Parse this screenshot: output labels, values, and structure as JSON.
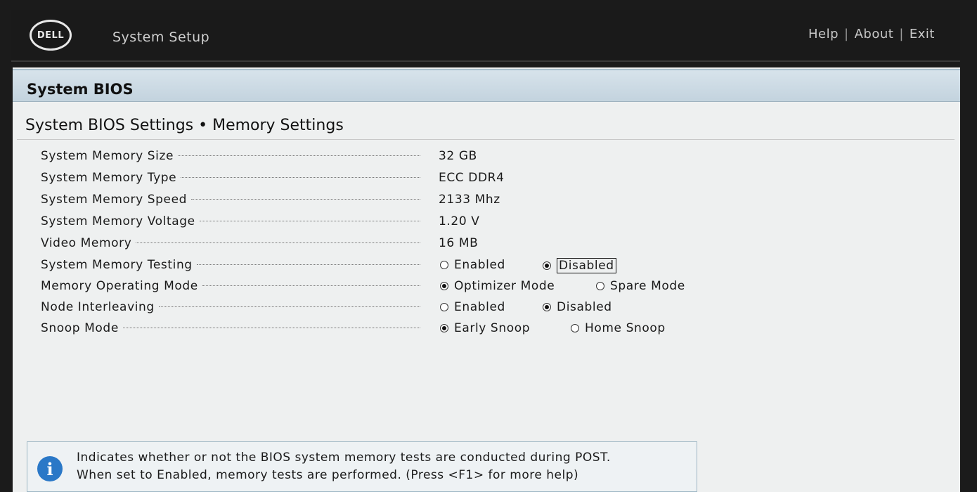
{
  "header": {
    "logo_text": "DELL",
    "app_title": "System Setup",
    "links": [
      "Help",
      "About",
      "Exit"
    ],
    "separator": "|"
  },
  "section": {
    "title": "System BIOS"
  },
  "page": {
    "title": "System BIOS Settings • Memory Settings"
  },
  "settings": [
    {
      "label": "System Memory Size",
      "value": "32 GB"
    },
    {
      "label": "System Memory Type",
      "value": "ECC DDR4"
    },
    {
      "label": "System Memory Speed",
      "value": "2133 Mhz"
    },
    {
      "label": "System Memory Voltage",
      "value": "1.20 V"
    },
    {
      "label": "Video Memory",
      "value": "16 MB"
    },
    {
      "label": "System Memory Testing",
      "options": [
        "Enabled",
        "Disabled"
      ],
      "selected": "Disabled"
    },
    {
      "label": "Memory Operating Mode",
      "options": [
        "Optimizer Mode",
        "Spare Mode"
      ],
      "selected": "Optimizer Mode"
    },
    {
      "label": "Node Interleaving",
      "options": [
        "Enabled",
        "Disabled"
      ],
      "selected": "Disabled"
    },
    {
      "label": "Snoop Mode",
      "options": [
        "Early Snoop",
        "Home Snoop"
      ],
      "selected": "Early Snoop"
    }
  ],
  "help": {
    "icon": "info-icon",
    "line1": "Indicates whether or not the BIOS system memory tests are conducted during POST.",
    "line2": "When set to Enabled, memory tests are performed. (Press <F1> for more help)"
  },
  "colors": {
    "header_bg": "#1a1a1a",
    "section_bg": "#c8d8e2",
    "info_icon": "#2a78c7"
  }
}
